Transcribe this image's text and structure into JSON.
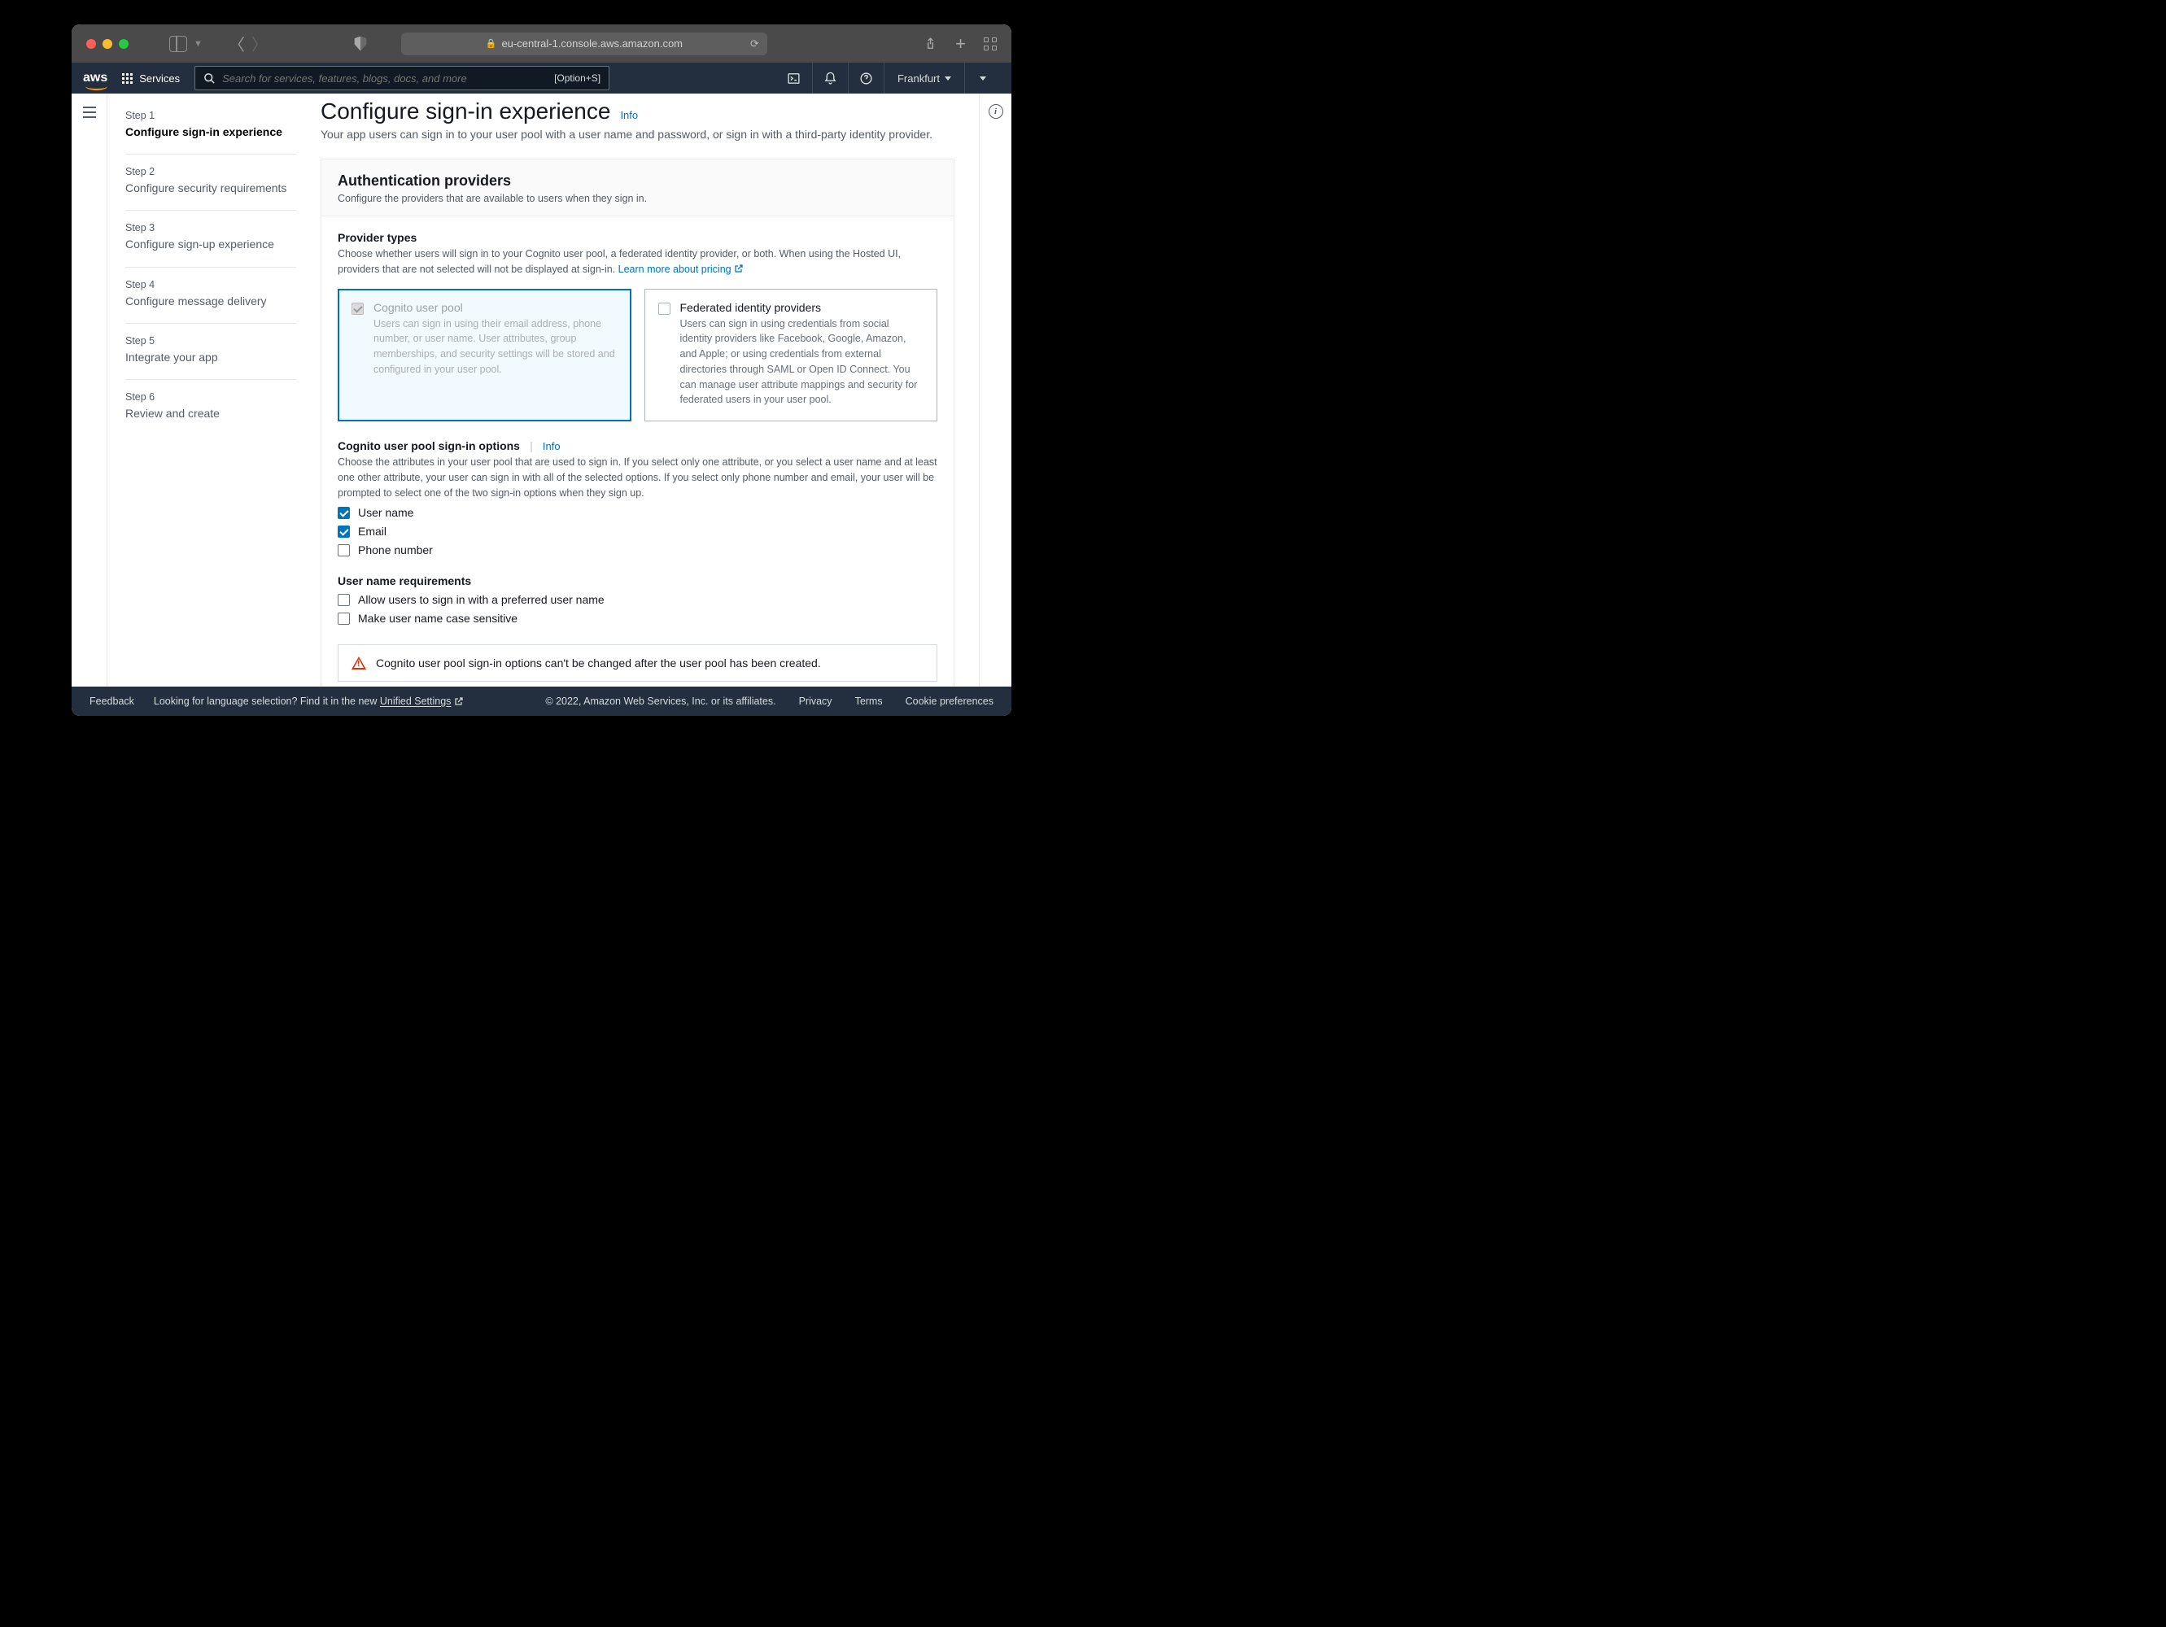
{
  "browser": {
    "url": "eu-central-1.console.aws.amazon.com"
  },
  "nav": {
    "services": "Services",
    "search_placeholder": "Search for services, features, blogs, docs, and more",
    "search_kbd": "[Option+S]",
    "region": "Frankfurt"
  },
  "steps": [
    {
      "n": "Step 1",
      "t": "Configure sign-in experience"
    },
    {
      "n": "Step 2",
      "t": "Configure security requirements"
    },
    {
      "n": "Step 3",
      "t": "Configure sign-up experience"
    },
    {
      "n": "Step 4",
      "t": "Configure message delivery"
    },
    {
      "n": "Step 5",
      "t": "Integrate your app"
    },
    {
      "n": "Step 6",
      "t": "Review and create"
    }
  ],
  "page": {
    "title": "Configure sign-in experience",
    "info": "Info",
    "sub": "Your app users can sign in to your user pool with a user name and password, or sign in with a third-party identity provider."
  },
  "panel": {
    "title": "Authentication providers",
    "desc": "Configure the providers that are available to users when they sign in."
  },
  "providers": {
    "title": "Provider types",
    "desc": "Choose whether users will sign in to your Cognito user pool, a federated identity provider, or both. When using the Hosted UI, providers that are not selected will not be displayed at sign-in. ",
    "learn": "Learn more about pricing",
    "cognito": {
      "title": "Cognito user pool",
      "desc": "Users can sign in using their email address, phone number, or user name. User attributes, group memberships, and security settings will be stored and configured in your user pool."
    },
    "federated": {
      "title": "Federated identity providers",
      "desc": "Users can sign in using credentials from social identity providers like Facebook, Google, Amazon, and Apple; or using credentials from external directories through SAML or Open ID Connect. You can manage user attribute mappings and security for federated users in your user pool."
    }
  },
  "signin": {
    "title": "Cognito user pool sign-in options",
    "info": "Info",
    "desc": "Choose the attributes in your user pool that are used to sign in. If you select only one attribute, or you select a user name and at least one other attribute, your user can sign in with all of the selected options. If you select only phone number and email, your user will be prompted to select one of the two sign-in options when they sign up.",
    "options": {
      "username": "User name",
      "email": "Email",
      "phone": "Phone number"
    }
  },
  "username_req": {
    "title": "User name requirements",
    "preferred": "Allow users to sign in with a preferred user name",
    "casesens": "Make user name case sensitive"
  },
  "warn": "Cognito user pool sign-in options can't be changed after the user pool has been created.",
  "footer": {
    "feedback": "Feedback",
    "lang": "Looking for language selection? Find it in the new ",
    "unified": "Unified Settings",
    "copyright": "© 2022, Amazon Web Services, Inc. or its affiliates.",
    "privacy": "Privacy",
    "terms": "Terms",
    "cookie": "Cookie preferences"
  }
}
